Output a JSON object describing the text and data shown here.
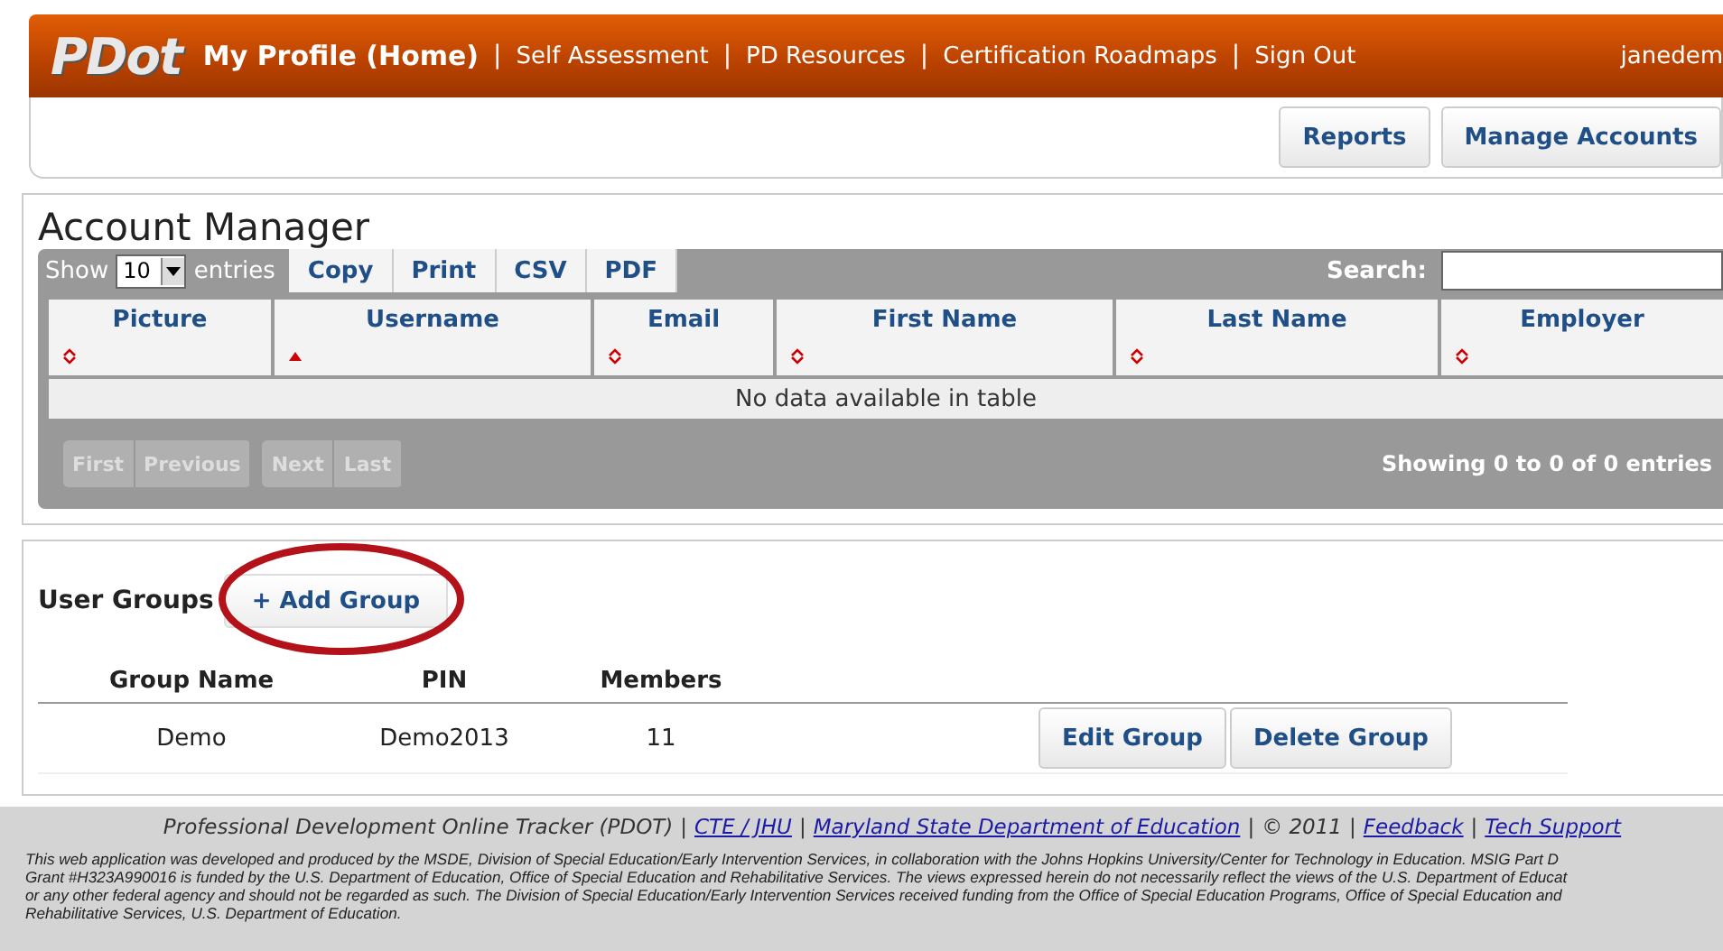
{
  "header": {
    "logo": "PDot",
    "nav": [
      {
        "label": "My Profile (Home)",
        "selected": true
      },
      {
        "label": "Self Assessment",
        "selected": false
      },
      {
        "label": "PD Resources",
        "selected": false
      },
      {
        "label": "Certification Roadmaps",
        "selected": false
      },
      {
        "label": "Sign Out",
        "selected": false
      }
    ],
    "separator": "|",
    "user": "janedem"
  },
  "toolbar": {
    "buttons": [
      "Reports",
      "Manage Accounts"
    ]
  },
  "account_manager": {
    "title": "Account Manager",
    "show_label": "Show",
    "page_size": "10",
    "entries_label": "entries",
    "export_buttons": [
      "Copy",
      "Print",
      "CSV",
      "PDF"
    ],
    "search_label": "Search:",
    "columns": [
      {
        "label": "Picture",
        "sorted": false
      },
      {
        "label": "Username",
        "sorted": true
      },
      {
        "label": "Email",
        "sorted": false
      },
      {
        "label": "First Name",
        "sorted": false
      },
      {
        "label": "Last Name",
        "sorted": false
      },
      {
        "label": "Employer",
        "sorted": false
      }
    ],
    "empty_message": "No data available in table",
    "pager": [
      [
        "First",
        "Previous"
      ],
      [
        "Next",
        "Last"
      ]
    ],
    "info": "Showing 0 to 0 of 0 entries"
  },
  "user_groups": {
    "title": "User Groups",
    "add_button": "+ Add Group",
    "highlighted": true,
    "columns": [
      "Group Name",
      "PIN",
      "Members"
    ],
    "rows": [
      {
        "cells": [
          "Demo",
          "Demo2013",
          "11"
        ],
        "actions": [
          "Edit Group",
          "Delete Group"
        ]
      }
    ]
  },
  "footer": {
    "separator": "|",
    "links": [
      {
        "text": "Professional Development Online Tracker (PDOT)",
        "link": false
      },
      {
        "text": "CTE / JHU",
        "link": true
      },
      {
        "text": "Maryland State Department of Education",
        "link": true
      },
      {
        "text": "© 2011",
        "link": false
      },
      {
        "text": "Feedback",
        "link": true
      },
      {
        "text": "Tech Support",
        "link": true
      }
    ],
    "disclaimer": [
      "This web application was developed and produced by the MSDE, Division of Special Education/Early Intervention Services, in collaboration with the Johns Hopkins University/Center for Technology in Education. MSIG Part D",
      "Grant #H323A990016 is funded by the U.S. Department of Education, Office of Special Education and Rehabilitative Services. The views expressed herein do not necessarily reflect the views of the U.S. Department of Educat",
      "or any other federal agency and should not be regarded as such. The Division of Special Education/Early Intervention Services received funding from the Office of Special Education Programs, Office of Special Education and",
      "Rehabilitative Services, U.S. Department of Education."
    ]
  }
}
